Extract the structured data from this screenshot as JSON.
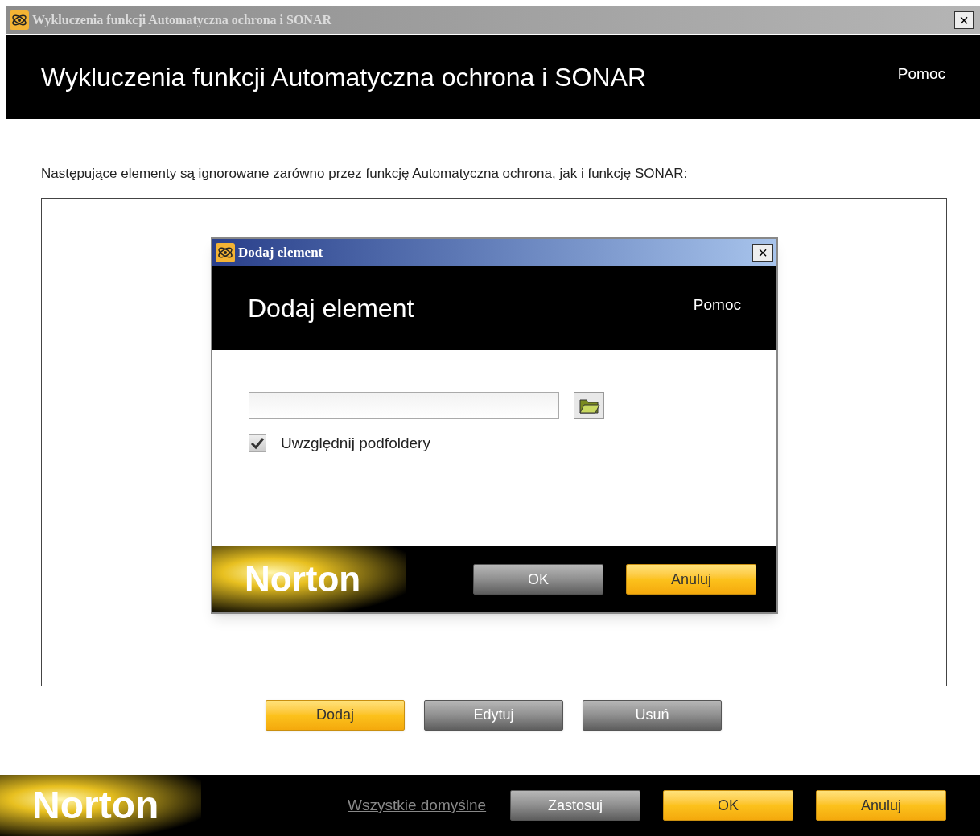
{
  "window": {
    "title": "Wykluczenia funkcji Automatyczna ochrona i SONAR",
    "close": "×"
  },
  "header": {
    "title": "Wykluczenia funkcji Automatyczna ochrona i SONAR",
    "help": "Pomoc"
  },
  "description": "Następujące elementy są ignorowane zarówno przez funkcję Automatyczna ochrona, jak i funkcję SONAR:",
  "dialog": {
    "title": "Dodaj element",
    "close": "×",
    "header": {
      "title": "Dodaj element",
      "help": "Pomoc"
    },
    "checkbox": {
      "label": "Uwzględnij podfoldery",
      "checked": true
    },
    "logo": "Norton",
    "buttons": [
      {
        "label": "OK",
        "kind": "secondary"
      },
      {
        "label": "Anuluj",
        "kind": "primary"
      }
    ]
  },
  "list_buttons": [
    {
      "label": "Dodaj",
      "kind": "primary"
    },
    {
      "label": "Edytuj",
      "kind": "secondary"
    },
    {
      "label": "Usuń",
      "kind": "secondary"
    }
  ],
  "footer": {
    "logo": "Norton",
    "link": "Wszystkie domyślne",
    "buttons": [
      {
        "label": "Zastosuj",
        "kind": "secondary"
      },
      {
        "label": "OK",
        "kind": "primary"
      },
      {
        "label": "Anuluj",
        "kind": "primary"
      }
    ]
  }
}
